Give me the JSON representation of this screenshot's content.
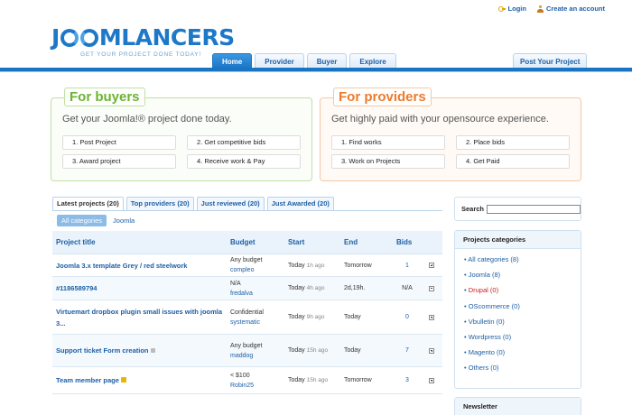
{
  "header": {
    "login_label": "Login",
    "create_account_label": "Create an account",
    "logo_part1": "J",
    "logo_part2": "MLANCERS",
    "tagline": "GET YOUR PROJECT DONE TODAY!"
  },
  "nav": {
    "tabs": [
      "Home",
      "Provider",
      "Buyer",
      "Explore"
    ],
    "active": "Home",
    "post_project_label": "Post Your Project"
  },
  "buyers": {
    "title": "For buyers",
    "subtitle": "Get your Joomla!® project done today.",
    "steps": [
      "1. Post Project",
      "2. Get competitive bids",
      "3. Award project",
      "4. Receive work & Pay"
    ]
  },
  "providers": {
    "title": "For providers",
    "subtitle": "Get highly paid with your opensource experience.",
    "steps": [
      "1. Find works",
      "2. Place bids",
      "3. Work on Projects",
      "4. Get Paid"
    ]
  },
  "project_tabs": [
    "Latest projects (20)",
    "Top providers (20)",
    "Just reviewed (20)",
    "Just Awarded (20)"
  ],
  "category_filters": [
    "All categories",
    "Joomla"
  ],
  "table": {
    "columns": [
      "Project title",
      "Budget",
      "Start",
      "End",
      "Bids"
    ],
    "rows": [
      {
        "title": "Joomla 3.x template Grey / red steelwork",
        "budget": "Any budget",
        "user": "compleo",
        "start": "Today",
        "ago": "1h ago",
        "end": "Tomorrow",
        "bids": "1"
      },
      {
        "title": "#1186589794",
        "budget": "N/A",
        "user": "fredalva",
        "start": "Today",
        "ago": "4h ago",
        "end": "2d,19h.",
        "bids": "N/A"
      },
      {
        "title": "Virtuemart dropbox plugin small issues with joomla 3...",
        "budget": "Confidential",
        "user": "systematic",
        "start": "Today",
        "ago": "9h ago",
        "end": "Today",
        "bids": "0"
      },
      {
        "title": "Support ticket Form creation",
        "budget": "Any budget",
        "user": "maddog",
        "start": "Today",
        "ago": "15h ago",
        "end": "Today",
        "bids": "7"
      },
      {
        "title": "Team member page",
        "budget": "< $100",
        "user": "Robin25",
        "start": "Today",
        "ago": "15h ago",
        "end": "Tomorrow",
        "bids": "3"
      }
    ]
  },
  "sidebar": {
    "search_label": "Search",
    "categories_title": "Projects categories",
    "categories": [
      "All categories (8)",
      "Joomla (8)",
      "Drupal (0)",
      "OScommerce (0)",
      "Vbulletin (0)",
      "Wordpress (0)",
      "Magento (0)",
      "Others (0)"
    ],
    "newsletter_title": "Newsletter"
  },
  "colors": {
    "brand_blue": "#1a74c4",
    "buyers_green": "#6ab42e",
    "providers_orange": "#ef7a2a",
    "highlight_red": "#cc1a1a"
  }
}
